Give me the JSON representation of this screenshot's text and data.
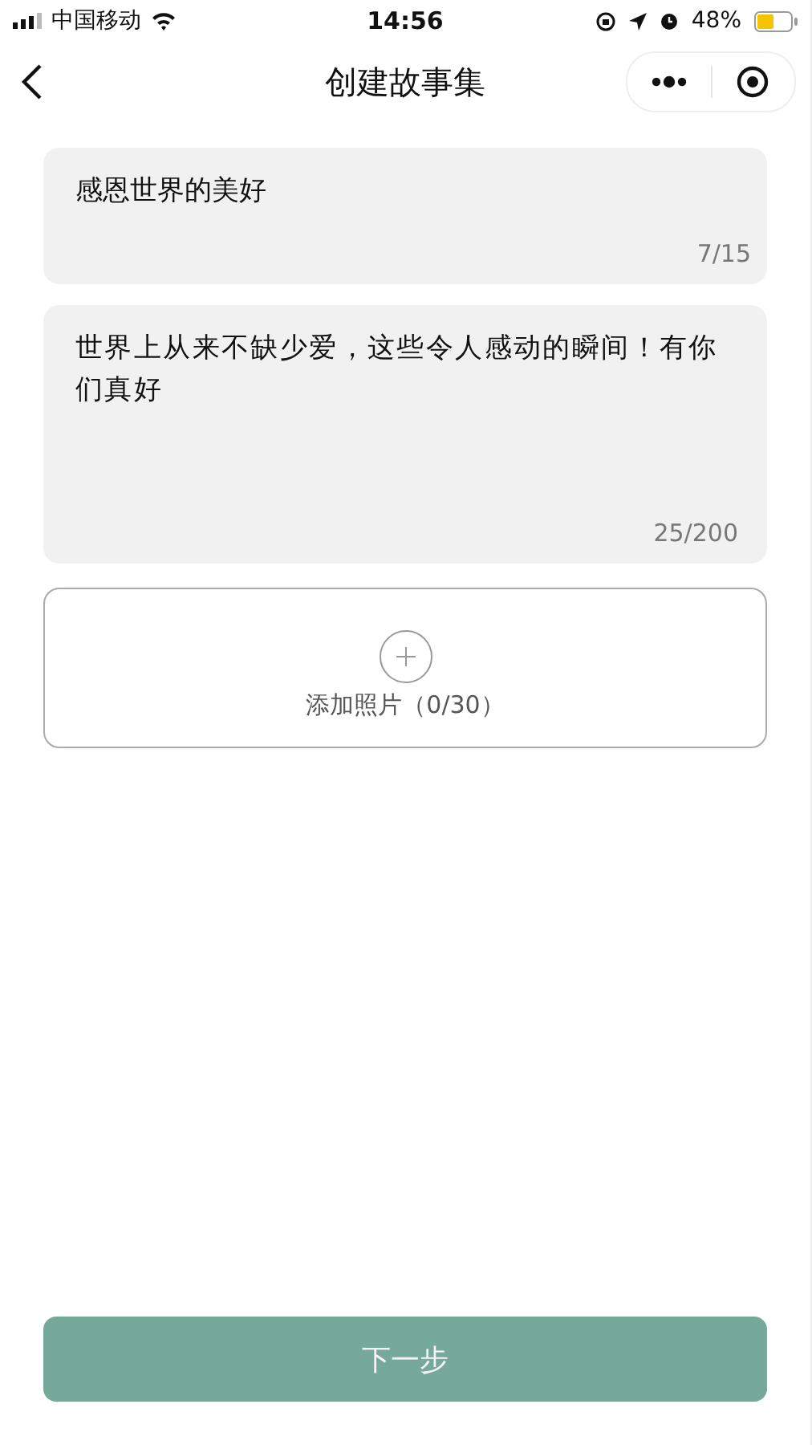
{
  "status_bar": {
    "carrier": "中国移动",
    "time": "14:56",
    "battery": "48%"
  },
  "nav": {
    "title": "创建故事集"
  },
  "fields": [
    {
      "kind": "single",
      "value": "感恩世界的美好",
      "counter": "7/15"
    },
    {
      "kind": "multi",
      "value": "世界上从来不缺少爱，这些令人感动的瞬间！有你们真好",
      "counter": "25/200"
    }
  ],
  "photo_upload": {
    "label": "添加照片（0/30）"
  },
  "next_button": {
    "label": "下一步",
    "disabled": true
  }
}
